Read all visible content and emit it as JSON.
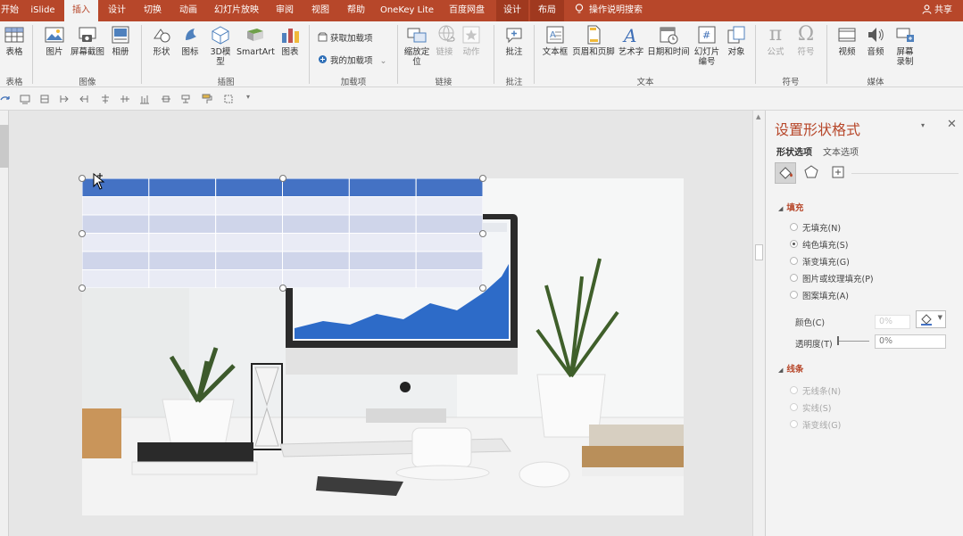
{
  "tabs": [
    {
      "label": "开始",
      "active": false
    },
    {
      "label": "iSlide",
      "active": false
    },
    {
      "label": "插入",
      "active": true
    },
    {
      "label": "设计",
      "active": false
    },
    {
      "label": "切换",
      "active": false
    },
    {
      "label": "动画",
      "active": false
    },
    {
      "label": "幻灯片放映",
      "active": false
    },
    {
      "label": "审阅",
      "active": false
    },
    {
      "label": "视图",
      "active": false
    },
    {
      "label": "帮助",
      "active": false
    },
    {
      "label": "OneKey Lite",
      "active": false
    },
    {
      "label": "百度网盘",
      "active": false
    },
    {
      "label": "设计",
      "active": false,
      "contextual": true
    },
    {
      "label": "布局",
      "active": false,
      "contextual": true
    }
  ],
  "search_label": "操作说明搜索",
  "share_label": "共享",
  "ribbon": {
    "buttons": {
      "table": "表格",
      "picture": "图片",
      "screenshot": "屏幕截图",
      "album": "相册",
      "shapes": "形状",
      "icons": "图标",
      "model3d": "3D模型",
      "smartart": "SmartArt",
      "chart": "图表",
      "get_addins": "获取加载项",
      "my_addins": "我的加载项",
      "zoom": "缩放定位",
      "link": "链接",
      "action": "动作",
      "comment": "批注",
      "textbox": "文本框",
      "header_footer": "页眉和页脚",
      "wordart": "艺术字",
      "datetime": "日期和时间",
      "slide_number": "幻灯片编号",
      "object": "对象",
      "equation": "公式",
      "symbol": "符号",
      "video": "视频",
      "audio": "音频",
      "screen_record": "屏幕录制"
    },
    "groups": {
      "tables": "表格",
      "images": "图像",
      "illustrations": "插图",
      "addins": "加载项",
      "links": "链接",
      "comments": "批注",
      "text": "文本",
      "symbols": "符号",
      "media": "媒体"
    }
  },
  "slide": {
    "table": {
      "columns": 6,
      "rows": 6,
      "header_color": "#4472c4",
      "band_dark": "#cfd5ea",
      "band_light": "#e9ebf5"
    }
  },
  "pane": {
    "title": "设置形状格式",
    "tabs": {
      "shape": "形状选项",
      "text": "文本选项"
    },
    "fill": {
      "header": "填充",
      "options": [
        {
          "label": "无填充(N)",
          "checked": false
        },
        {
          "label": "纯色填充(S)",
          "checked": true
        },
        {
          "label": "渐变填充(G)",
          "checked": false
        },
        {
          "label": "图片或纹理填充(P)",
          "checked": false
        },
        {
          "label": "图案填充(A)",
          "checked": false
        }
      ],
      "color_label": "颜色(C)",
      "transparency_label": "透明度(T)",
      "transparency_value": "0%",
      "ghost_transparency_value": "0%"
    },
    "line": {
      "header": "线条",
      "options": [
        {
          "label": "无线条(N)"
        },
        {
          "label": "实线(S)"
        },
        {
          "label": "渐变线(G)"
        }
      ]
    }
  },
  "colors": {
    "accent": "#b7472a",
    "ribbon_bg": "#f3f3f3",
    "table_header": "#4472c4"
  }
}
